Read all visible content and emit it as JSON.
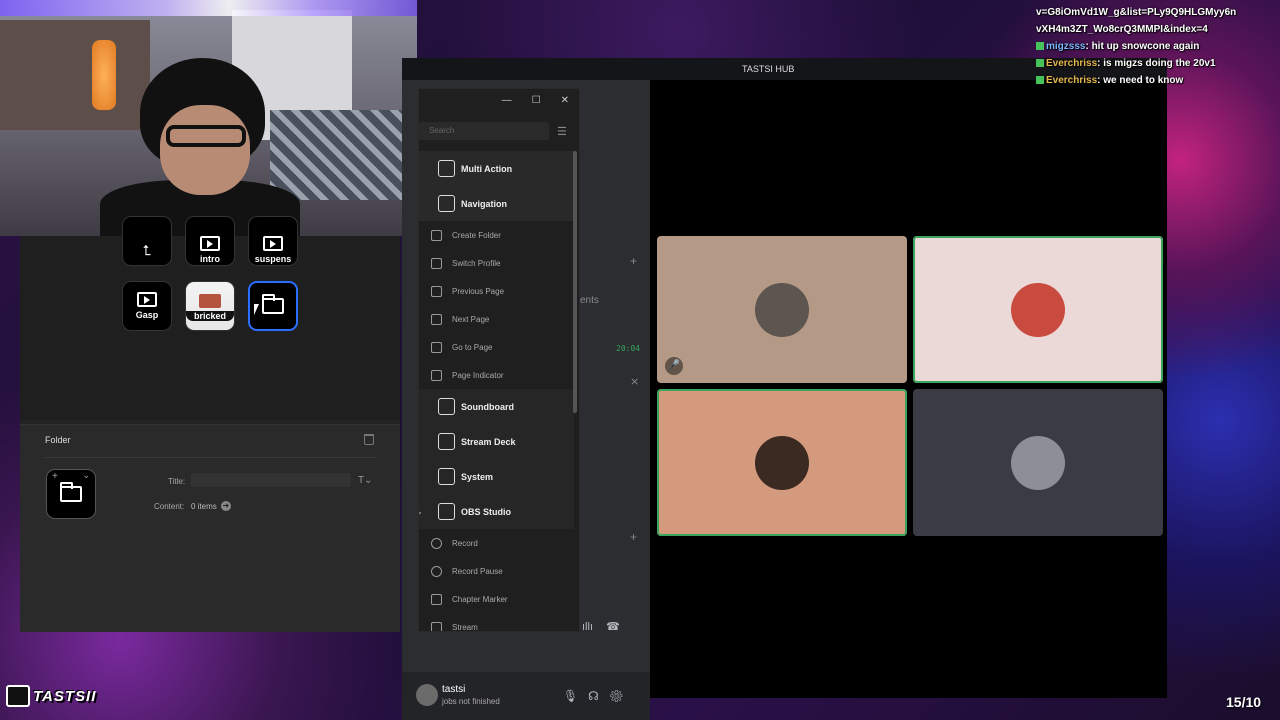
{
  "chat": {
    "line1": "v=G8iOmVd1W_g&list=PLy9Q9HLGMyy6n",
    "line2": "vXH4m3ZT_Wo8crQ3MMPI&index=4",
    "messages": [
      {
        "user": "migzsss",
        "text": ": hit up snowcone again"
      },
      {
        "user": "Everchriss",
        "text": ": is migzs doing the 20v1"
      },
      {
        "user": "Everchriss",
        "text": ": we need to know"
      }
    ]
  },
  "streamdeck": {
    "keys": [
      {
        "label": ""
      },
      {
        "label": "intro"
      },
      {
        "label": "suspens"
      },
      {
        "label": "Gasp"
      },
      {
        "label": "bricked"
      },
      {
        "label": ""
      }
    ],
    "props": {
      "title": "Folder",
      "title_label": "Title:",
      "title_icon": "T",
      "content_label": "Content:",
      "content_value": "0 items"
    }
  },
  "picker": {
    "search_placeholder": "Search",
    "items": [
      {
        "label": "Multi Action",
        "kind": "cat"
      },
      {
        "label": "Navigation",
        "kind": "cat"
      },
      {
        "label": "Create Folder",
        "kind": "sub"
      },
      {
        "label": "Switch Profile",
        "kind": "sub"
      },
      {
        "label": "Previous Page",
        "kind": "sub"
      },
      {
        "label": "Next Page",
        "kind": "sub"
      },
      {
        "label": "Go to Page",
        "kind": "sub"
      },
      {
        "label": "Page Indicator",
        "kind": "sub"
      },
      {
        "label": "Soundboard",
        "kind": "cat",
        "arrow": "›"
      },
      {
        "label": "Stream Deck",
        "kind": "cat",
        "arrow": "›"
      },
      {
        "label": "System",
        "kind": "cat",
        "arrow": "›"
      },
      {
        "label": "OBS Studio",
        "kind": "cat",
        "arrow": "⌄"
      },
      {
        "label": "Record",
        "kind": "sub",
        "round": true
      },
      {
        "label": "Record Pause",
        "kind": "sub",
        "round": true
      },
      {
        "label": "Chapter Marker",
        "kind": "sub"
      },
      {
        "label": "Stream",
        "kind": "sub"
      }
    ]
  },
  "discord": {
    "title": "TASTSI HUB",
    "channel_text_partial": "ents",
    "time": "20:04",
    "user": {
      "name": "tastsi",
      "status": "jobs not finished"
    },
    "tiles": [
      {
        "color": "#b49a86",
        "avatar": "#5d5550",
        "speaking": false,
        "muted": true
      },
      {
        "color": "#ead9d7",
        "avatar": "#c94a3e",
        "speaking": true,
        "muted": false
      },
      {
        "color": "#d39a7d",
        "avatar": "#3a2a22",
        "speaking": true,
        "muted": false
      },
      {
        "color": "#3a3b44",
        "avatar": "#8e8f96",
        "speaking": false,
        "muted": false
      }
    ]
  },
  "brand": "TASTSII",
  "counter": "15/10"
}
